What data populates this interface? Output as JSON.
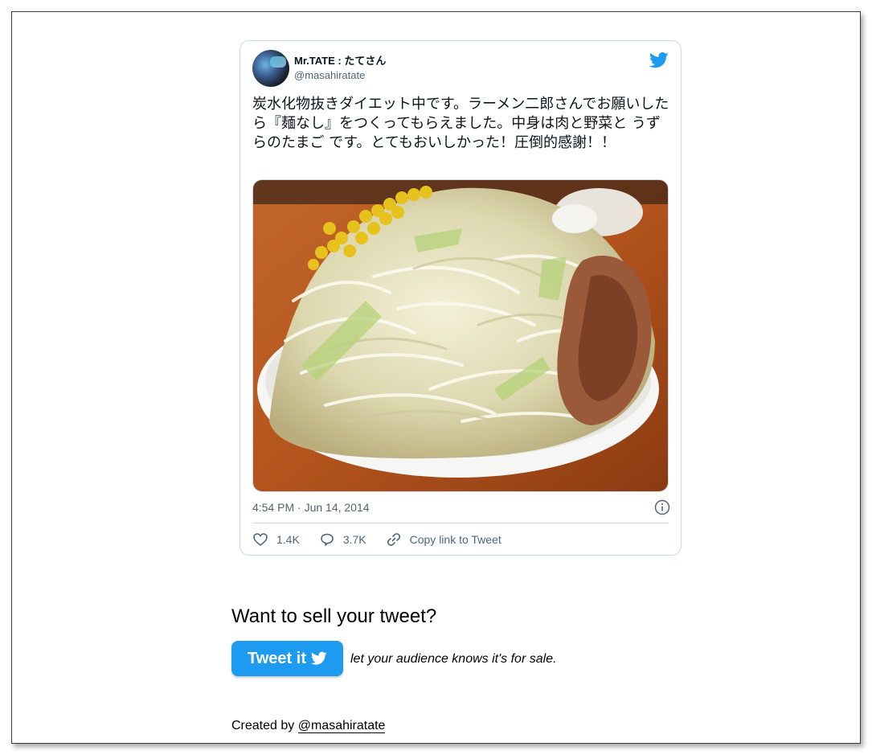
{
  "tweet": {
    "display_name": "Mr.TATE : たてさん",
    "handle": "@masahiratate",
    "text": "炭水化物抜きダイエット中です。ラーメン二郎さんでお願いしたら『麺なし』をつくってもらえました。中身は肉と野菜と うずらのたまご です。とてもおいしかった！圧倒的感謝！！",
    "timestamp": "4:54 PM · Jun 14, 2014",
    "likes": "1.4K",
    "replies": "3.7K",
    "copy_link": "Copy link to Tweet"
  },
  "sell": {
    "heading": "Want to sell your tweet?",
    "button_label": "Tweet it",
    "note": "let your audience knows it's for sale."
  },
  "footer": {
    "created_by": "Created by",
    "author_link": "@masahiratate"
  },
  "colors": {
    "twitter_blue": "#1d9bf0",
    "secondary_text": "#536471",
    "border": "#cfd9de"
  },
  "icons": [
    "twitter-bird-icon",
    "info-icon",
    "heart-icon",
    "reply-icon",
    "link-icon"
  ]
}
